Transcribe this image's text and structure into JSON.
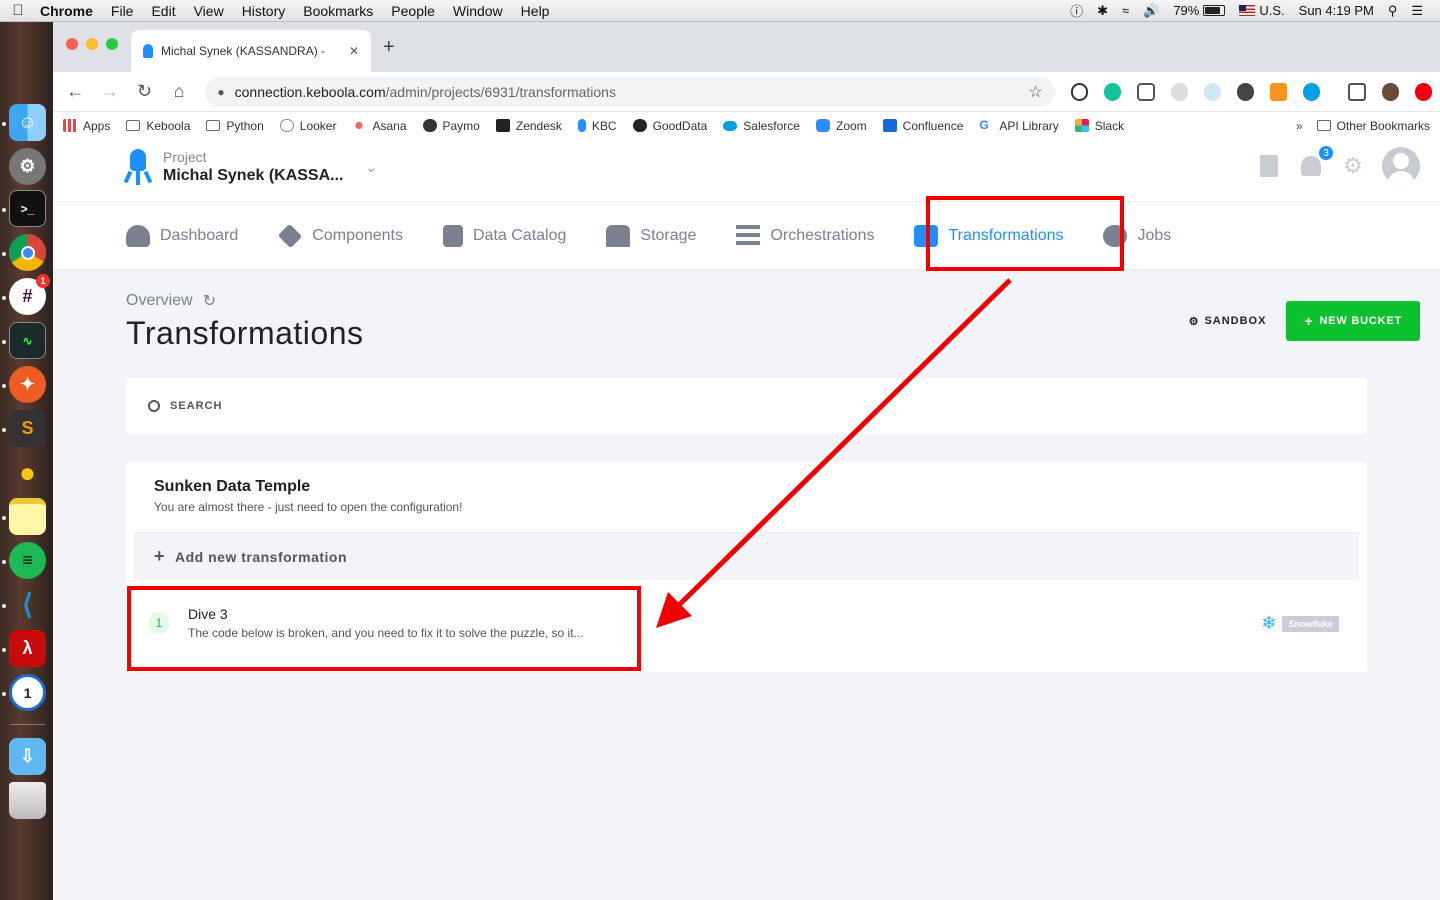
{
  "menubar": {
    "app": "Chrome",
    "items": [
      "File",
      "Edit",
      "View",
      "History",
      "Bookmarks",
      "People",
      "Window",
      "Help"
    ],
    "battery": "79%",
    "input_source": "U.S.",
    "clock": "Sun 4:19 PM"
  },
  "dock": {
    "apps": [
      "finder-icon",
      "system-preferences-icon",
      "terminal-icon",
      "chrome-icon",
      "slack-icon",
      "activity-monitor-icon",
      "postman-icon",
      "sublime-text-icon",
      "cyberduck-icon",
      "notes-icon",
      "spotify-icon",
      "vscode-icon",
      "acrobat-icon",
      "1password-icon",
      "downloads-icon",
      "trash-icon"
    ],
    "slack_badge": "1"
  },
  "browser": {
    "tab_title": "Michal Synek (KASSANDRA) - ",
    "url_host": "connection.keboola.com",
    "url_path": "/admin/projects/6931/transformations",
    "bookmarks": [
      "Apps",
      "Keboola",
      "Python",
      "Looker",
      "Asana",
      "Paymo",
      "Zendesk",
      "KBC",
      "GoodData",
      "Salesforce",
      "Zoom",
      "Confluence",
      "API Library",
      "Slack"
    ],
    "other_bookmarks": "Other Bookmarks",
    "more": "»"
  },
  "header": {
    "project_label": "Project",
    "project_name": "Michal Synek (KASSA...",
    "notifications_count": "3"
  },
  "nav": {
    "items": [
      "Dashboard",
      "Components",
      "Data Catalog",
      "Storage",
      "Orchestrations",
      "Transformations",
      "Jobs"
    ],
    "active": "Transformations"
  },
  "main": {
    "breadcrumb": "Overview",
    "title": "Transformations",
    "sandbox_label": "SANDBOX",
    "new_bucket_label": "NEW BUCKET",
    "search_placeholder": "SEARCH",
    "bucket": {
      "name": "Sunken Data Temple",
      "description": "You are almost there - just need to open the configuration!",
      "add_label": "Add new transformation",
      "rows": [
        {
          "num": "1",
          "title": "Dive 3",
          "description": "The code below is broken, and you need to fix it to solve the puzzle, so it...",
          "backend": "Snowflake"
        }
      ]
    }
  },
  "colors": {
    "accent": "#1f8fff",
    "primary_button": "#0bc22e",
    "annotation": "#f20000",
    "page_bg": "#f2f4f7"
  }
}
